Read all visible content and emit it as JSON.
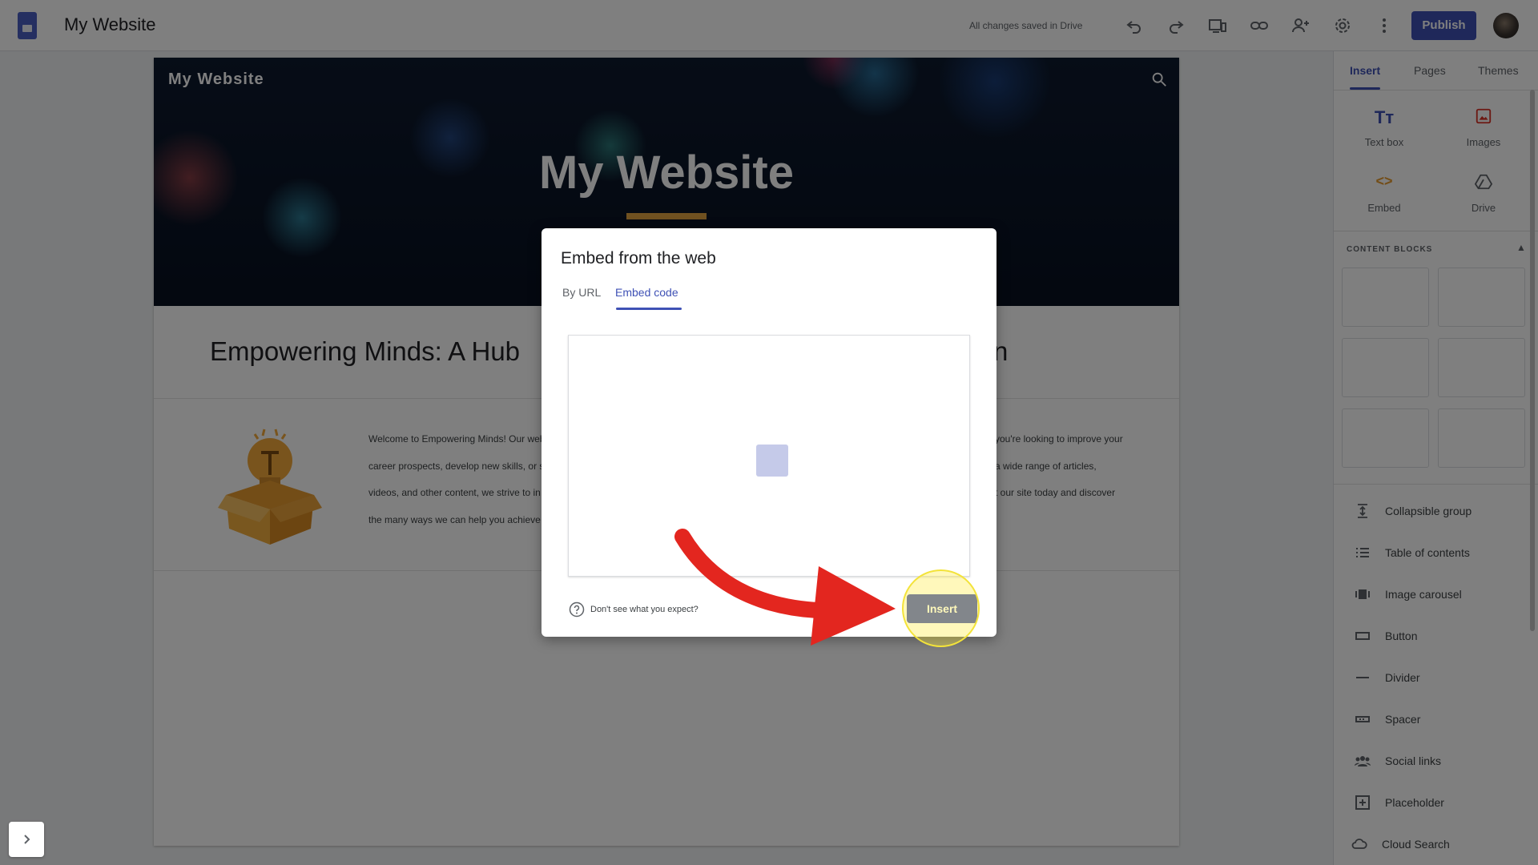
{
  "topbar": {
    "title": "My Website",
    "save_status": "All changes saved in Drive",
    "icons": [
      "undo-icon",
      "redo-icon",
      "preview-icon",
      "link-icon",
      "share-icon",
      "settings-icon",
      "more-icon"
    ],
    "publish_label": "Publish"
  },
  "site": {
    "header_title": "My Website",
    "hero_title": "My Website",
    "heading": "Empowering Minds: A Hub",
    "heading_tail": "n",
    "body_left": [
      "Welcome to Empowering Minds! Our web",
      "career prospects, develop new skills, or s",
      "videos, and other content, we strive to in",
      "the many ways we can help you achieve y"
    ],
    "body_right": [
      "you're looking to improve your",
      "a wide range of articles,",
      "t our site today and discover",
      ""
    ],
    "accent_color": "#e0a341"
  },
  "dialog": {
    "title": "Embed from the web",
    "tabs": [
      {
        "label": "By URL",
        "active": false
      },
      {
        "label": "Embed code",
        "active": true
      }
    ],
    "help_text": "Don't see what you expect?",
    "insert_label": "Insert"
  },
  "panel": {
    "tabs": [
      {
        "label": "Insert",
        "active": true
      },
      {
        "label": "Pages",
        "active": false
      },
      {
        "label": "Themes",
        "active": false
      }
    ],
    "tools": [
      {
        "label": "Text box",
        "icon": "text-box-icon"
      },
      {
        "label": "Images",
        "icon": "images-icon"
      },
      {
        "label": "Embed",
        "icon": "embed-icon"
      },
      {
        "label": "Drive",
        "icon": "drive-icon"
      }
    ],
    "content_blocks_label": "CONTENT BLOCKS",
    "items": [
      {
        "label": "Collapsible group",
        "icon": "collapsible-group-icon"
      },
      {
        "label": "Table of contents",
        "icon": "table-of-contents-icon"
      },
      {
        "label": "Image carousel",
        "icon": "image-carousel-icon"
      },
      {
        "label": "Button",
        "icon": "button-icon"
      },
      {
        "label": "Divider",
        "icon": "divider-icon"
      },
      {
        "label": "Spacer",
        "icon": "spacer-icon"
      },
      {
        "label": "Social links",
        "icon": "social-links-icon"
      },
      {
        "label": "Placeholder",
        "icon": "placeholder-icon"
      },
      {
        "label": "Cloud Search",
        "icon": "cloud-search-icon"
      }
    ]
  },
  "colors": {
    "brand": "#3f51b5",
    "highlight": "#f3e33a",
    "arrow": "#e3261f"
  }
}
